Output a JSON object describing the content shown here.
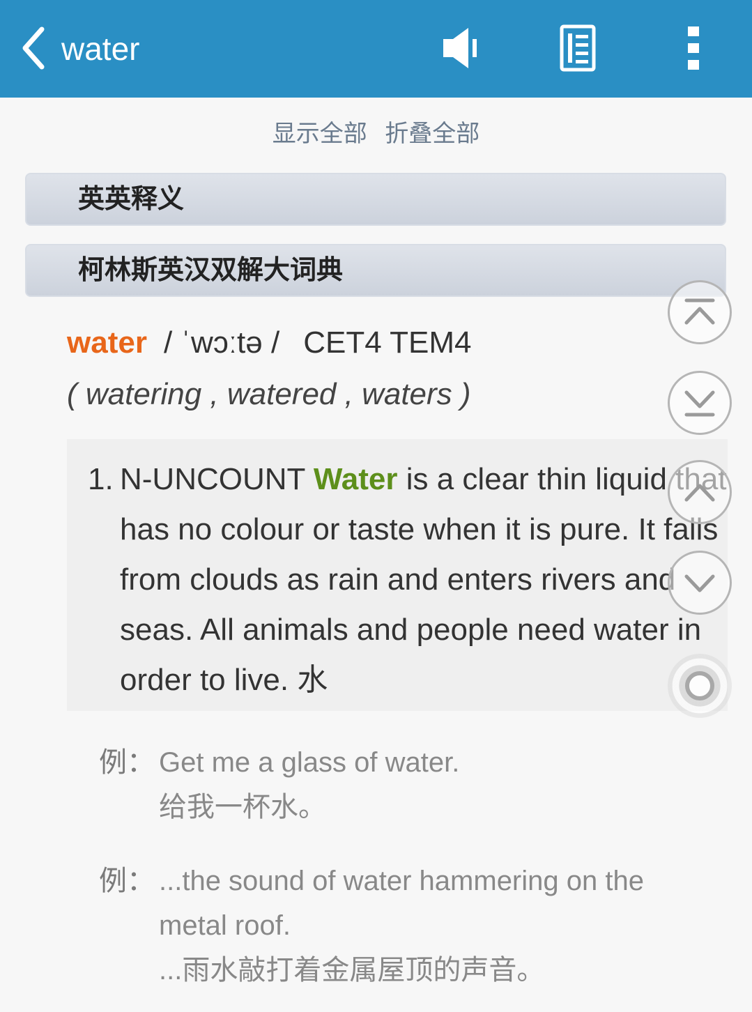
{
  "header": {
    "title": "water",
    "back_icon": "chevron-left-icon",
    "speaker_icon": "speaker-icon",
    "list_icon": "list-icon",
    "more_icon": "more-vertical-icon"
  },
  "toggles": {
    "show_all": "显示全部",
    "collapse_all": "折叠全部"
  },
  "sections": [
    {
      "title": "英英释义"
    },
    {
      "title": "柯林斯英汉双解大词典"
    }
  ],
  "entry": {
    "headword": "water",
    "phonetic": "/ ˈwɔːtə /",
    "levels": "CET4 TEM4",
    "forms": "( watering , watered , waters )"
  },
  "definition": {
    "number": "1.",
    "pos": "N-UNCOUNT",
    "keyword": "Water",
    "text": "is a clear thin liquid that has no colour or taste when it is pure. It falls from clouds as rain and enters rivers and seas. All animals and people need water in order to live. 水"
  },
  "examples": [
    {
      "label": "例：",
      "en": "Get me a glass of water.",
      "zh": "给我一杯水。"
    },
    {
      "label": "例：",
      "en": "...the sound of water hammering on the metal roof.",
      "zh": "...雨水敲打着金属屋顶的声音。"
    }
  ],
  "floating_buttons": [
    "scroll-top-icon",
    "scroll-bottom-icon",
    "chevron-up-icon",
    "chevron-down-icon",
    "target-icon"
  ],
  "colors": {
    "topbar": "#2a8fc4",
    "headword": "#e8661a",
    "keyword": "#5d8f1b"
  }
}
